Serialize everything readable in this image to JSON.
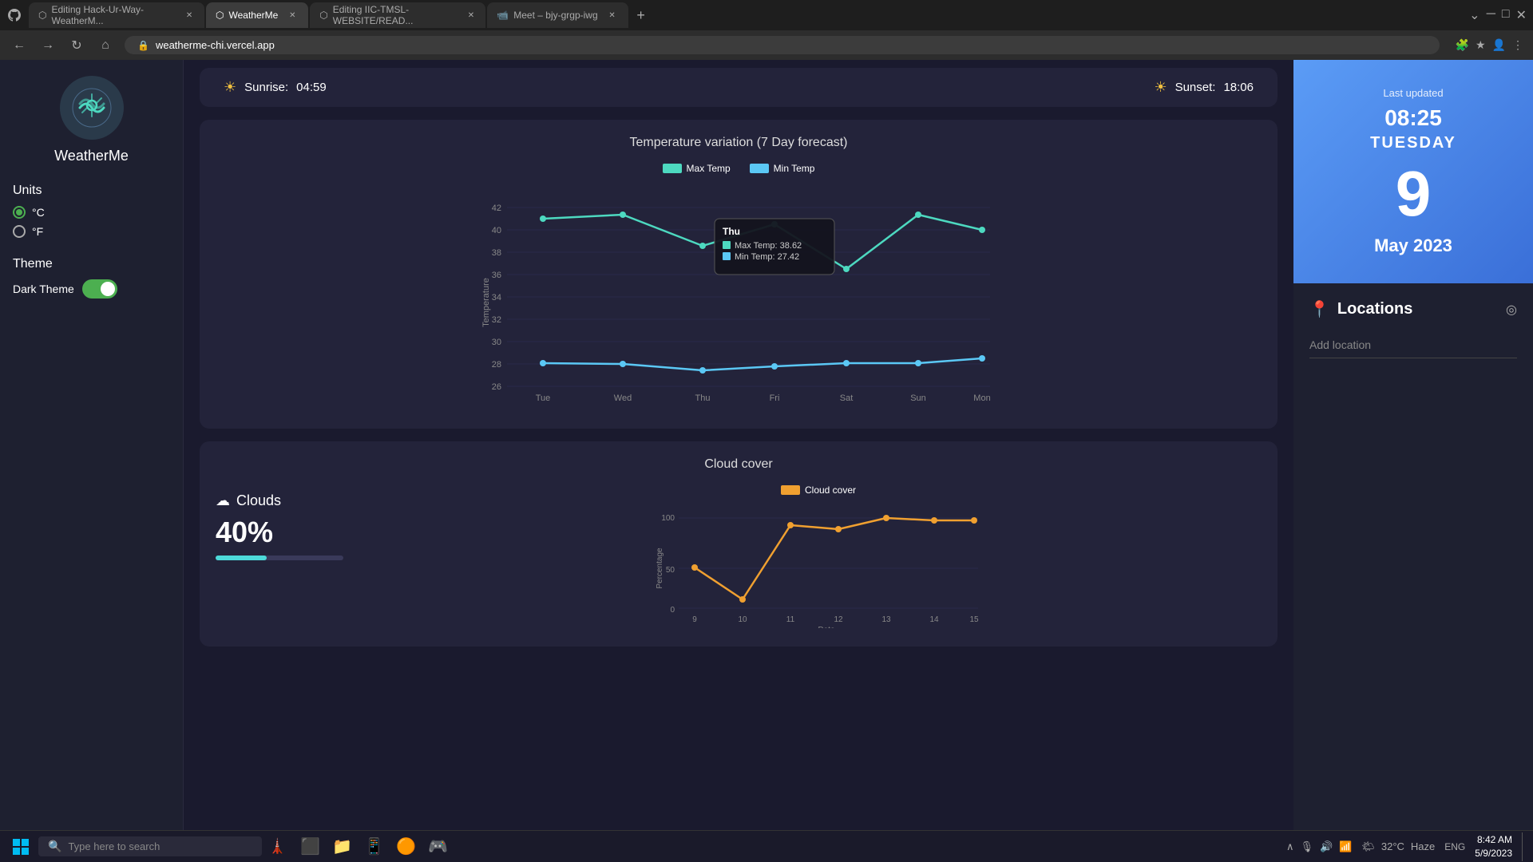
{
  "browser": {
    "tabs": [
      {
        "label": "Editing Hack-Ur-Way-WeatherM...",
        "active": false,
        "icon": "⬡"
      },
      {
        "label": "WeatherMe",
        "active": true,
        "icon": "⬡"
      },
      {
        "label": "Editing IIC-TMSL-WEBSITE/READ...",
        "active": false,
        "icon": "⬡"
      },
      {
        "label": "Meet – bjy-grgp-iwg",
        "active": false,
        "icon": "📹"
      }
    ],
    "url": "weatherme-chi.vercel.app"
  },
  "sidebar": {
    "app_name": "WeatherMe",
    "units_label": "Units",
    "celsius_label": "°C",
    "fahrenheit_label": "°F",
    "theme_label": "Theme",
    "dark_theme_label": "Dark Theme"
  },
  "sun": {
    "sunrise_label": "Sunrise:",
    "sunrise_time": "04:59",
    "sunset_label": "Sunset:",
    "sunset_time": "18:06"
  },
  "temp_chart": {
    "title": "Temperature variation (7 Day forecast)",
    "legend_max": "Max Temp",
    "legend_min": "Min Temp",
    "max_color": "#4dd9c0",
    "min_color": "#5bc8f5",
    "days": [
      "Tue",
      "Wed",
      "Thu",
      "Fri",
      "Sat",
      "Sun",
      "Mon"
    ],
    "max_temps": [
      41,
      41.5,
      38.62,
      40.5,
      36.5,
      41.5,
      40
    ],
    "min_temps": [
      28.1,
      28.0,
      27.42,
      27.8,
      28.1,
      28.1,
      28.5
    ],
    "tooltip": {
      "day": "Thu",
      "max_label": "Max Temp:",
      "max_val": "38.62",
      "min_label": "Min Temp:",
      "min_val": "27.42"
    }
  },
  "cloud_chart": {
    "title": "Cloud cover",
    "cloud_label": "Clouds",
    "cloud_percent": "40%",
    "cloud_bar_width": 40,
    "legend_label": "Cloud cover",
    "legend_color": "#f0a030",
    "dates": [
      "9",
      "10",
      "11",
      "12",
      "13",
      "14",
      "15"
    ],
    "values": [
      45,
      10,
      92,
      88,
      100,
      97,
      97
    ],
    "x_axis_label": "Date",
    "y_axis_max": 100,
    "y_axis_labels": [
      "100",
      "50",
      "0"
    ]
  },
  "date_panel": {
    "last_updated": "Last updated",
    "time": "08:25",
    "day": "TUESDAY",
    "date_number": "9",
    "month_year": "May 2023"
  },
  "locations": {
    "title": "Locations",
    "add_placeholder": "Add location"
  },
  "taskbar": {
    "search_placeholder": "Type here to search",
    "temp": "32°C",
    "condition": "Haze",
    "language": "ENG",
    "time": "8:42 AM",
    "date": "5/9/2023",
    "apps": [
      "🖼️",
      "📁",
      "📱",
      "🟠",
      "🎮"
    ]
  }
}
